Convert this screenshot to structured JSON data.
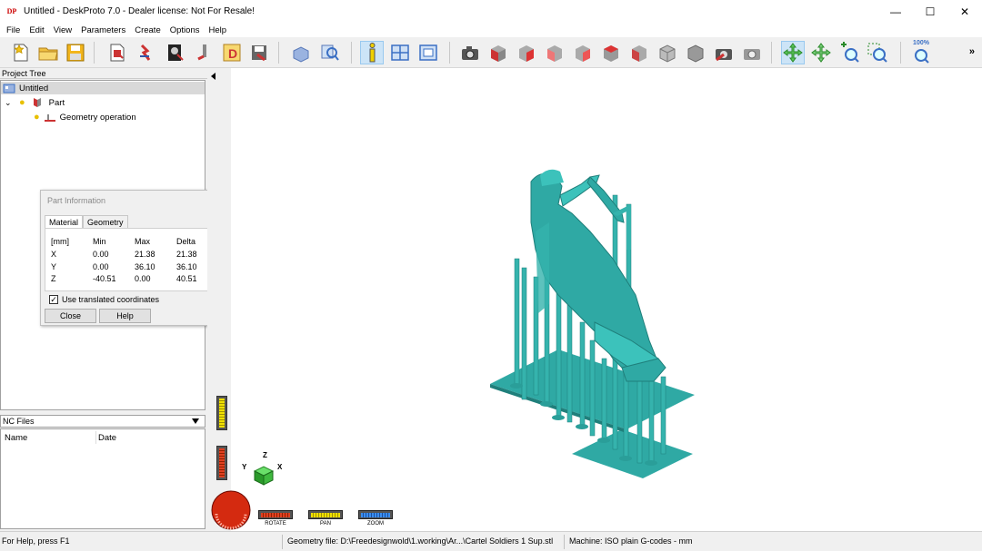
{
  "window": {
    "title": "Untitled - DeskProto 7.0 - Dealer license: Not For Resale!",
    "app_icon_text": "DP",
    "minimize_glyph": "—",
    "maximize_glyph": "☐",
    "close_glyph": "✕"
  },
  "menu": [
    "File",
    "Edit",
    "View",
    "Parameters",
    "Create",
    "Options",
    "Help"
  ],
  "toolbar": {
    "more_glyph": "»",
    "zoom_label": "100%",
    "buttons": [
      "new-icon",
      "open-folder-icon",
      "save-icon",
      "import-part-icon",
      "import-vector-icon",
      "import-bitmap-icon",
      "create-operation-icon",
      "drawing-icon",
      "export-icon",
      "show-part-icon",
      "find-icon",
      "info-icon",
      "layout-icon",
      "window-icon",
      "camera-icon",
      "view-front-icon",
      "view-back-icon",
      "view-left-icon",
      "view-right-icon",
      "view-top-icon",
      "view-bottom-icon",
      "view-iso-icon",
      "view-iso2-icon",
      "camera-reset-icon",
      "camera-gray-icon",
      "rotate-mode-icon",
      "pan-mode-icon",
      "zoom-in-icon",
      "zoom-window-icon",
      "zoom-100-icon"
    ]
  },
  "project_tree": {
    "header": "Project Tree",
    "items": [
      {
        "label": "Untitled",
        "level": 0
      },
      {
        "label": "Part",
        "level": 1
      },
      {
        "label": "Geometry operation",
        "level": 2
      }
    ]
  },
  "nc_files": {
    "header": "NC Files",
    "columns": [
      "Name",
      "Date"
    ]
  },
  "part_info_dialog": {
    "title": "Part Information",
    "tabs": [
      "Material",
      "Geometry"
    ],
    "active_tab": "Material",
    "headers": [
      "[mm]",
      "Min",
      "Max",
      "Delta"
    ],
    "rows": [
      [
        "X",
        "0.00",
        "21.38",
        "21.38"
      ],
      [
        "Y",
        "0.00",
        "36.10",
        "36.10"
      ],
      [
        "Z",
        "-40.51",
        "0.00",
        "40.51"
      ]
    ],
    "checkbox_label": "Use translated coordinates",
    "checkbox_checked": true,
    "close_label": "Close",
    "help_label": "Help"
  },
  "viewport": {
    "model_color": "#2fa9a4",
    "axes": {
      "z": "Z",
      "y": "Y",
      "x": "X"
    },
    "nav_bars": {
      "rotate": "ROTATE",
      "pan": "PAN",
      "zoom": "ZOOM"
    }
  },
  "status": {
    "help": "For Help, press F1",
    "geometry_file": "Geometry file: D:\\Freedesignwold\\1.working\\Ar...\\Cartel Soldiers 1 Sup.stl",
    "machine": "Machine: ISO plain G-codes - mm"
  }
}
